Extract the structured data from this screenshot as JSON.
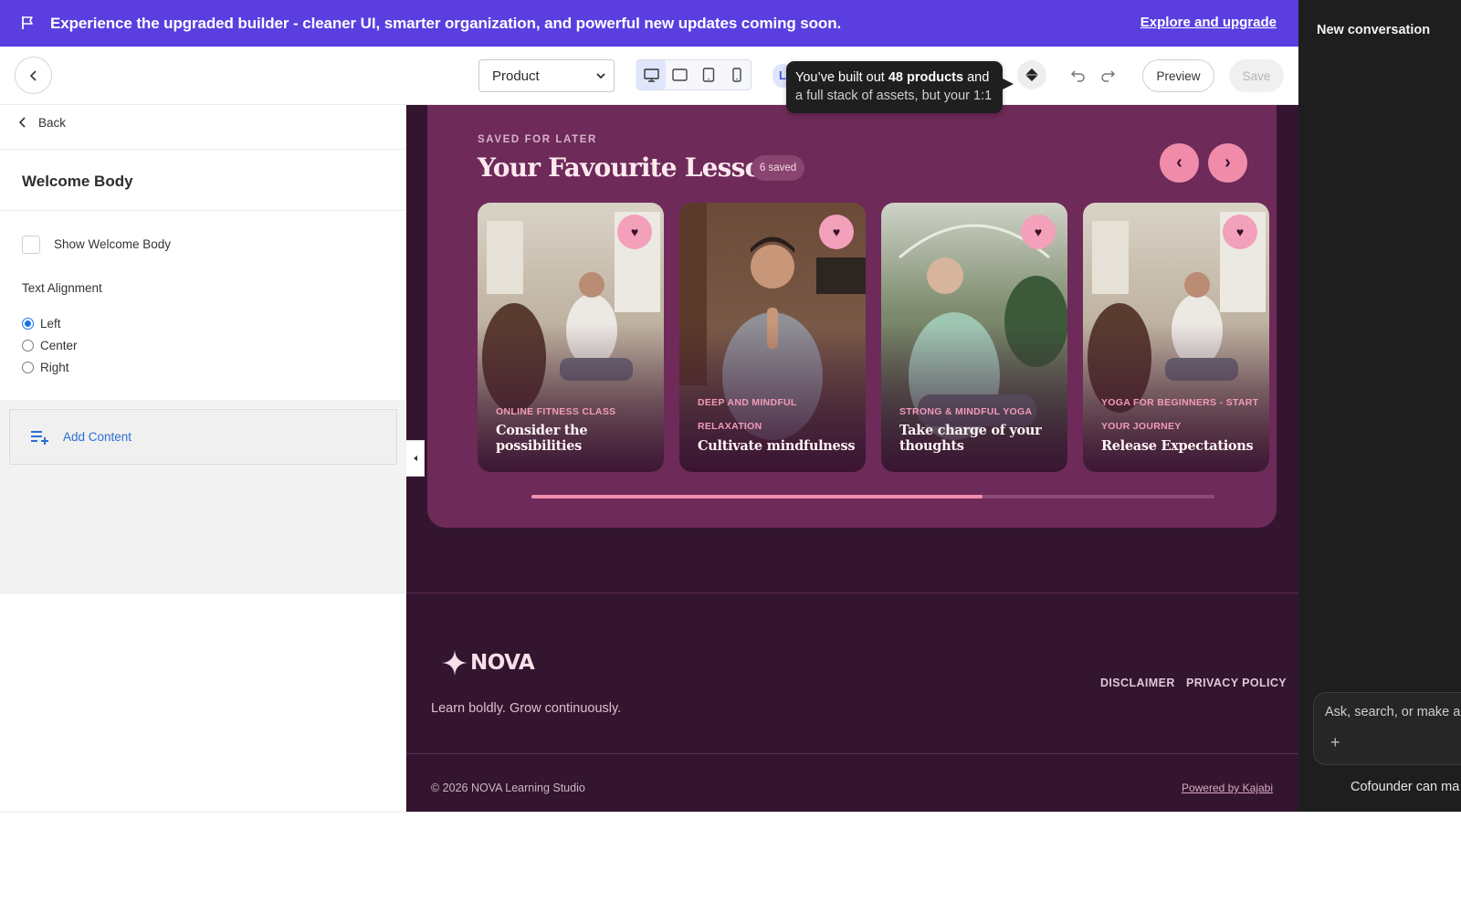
{
  "banner": {
    "message": "Experience the upgraded builder - cleaner UI, smarter organization, and powerful new updates coming soon.",
    "cta": "Explore and upgrade"
  },
  "toolbar": {
    "page_select": "Product",
    "language_chip": "L",
    "tooltip_line1_prefix": "You’ve built out ",
    "tooltip_line1_bold": "48 products",
    "tooltip_line1_suffix": " and",
    "tooltip_line2": "a full stack of assets, but your 1:1",
    "preview_label": "Preview",
    "save_label": "Save"
  },
  "left_panel": {
    "back_label": "Back",
    "title": "Welcome Body",
    "checkbox_label": "Show Welcome Body",
    "alignment_label": "Text Alignment",
    "alignment_options": [
      {
        "label": "Left",
        "checked": true
      },
      {
        "label": "Center",
        "checked": false
      },
      {
        "label": "Right",
        "checked": false
      }
    ],
    "add_content_label": "Add Content"
  },
  "canvas": {
    "eyebrow": "SAVED FOR LATER",
    "title": "Your Favourite Lessons",
    "saved_badge": "6 saved",
    "prev_label": "‹",
    "next_label": "›",
    "lessons": [
      {
        "category_lines": [
          "ONLINE FITNESS CLASS"
        ],
        "title_lines": [
          "Consider the",
          "possibilities"
        ]
      },
      {
        "category_lines": [
          "DEEP AND MINDFUL",
          "RELAXATION"
        ],
        "title_lines": [
          "Cultivate mindfulness"
        ]
      },
      {
        "category_lines": [
          "STRONG & MINDFUL YOGA"
        ],
        "title_lines": [
          "Take charge of your",
          "thoughts"
        ]
      },
      {
        "category_lines": [
          "YOGA FOR BEGINNERS - START",
          "YOUR JOURNEY"
        ],
        "title_lines": [
          "Release Expectations"
        ]
      }
    ],
    "carousel_progress": 0.66,
    "footer": {
      "logo_text": "NOVA",
      "tagline": "Learn boldly. Grow continuously.",
      "links": [
        "DISCLAIMER",
        "PRIVACY POLICY"
      ],
      "copyright": "© 2026 NOVA Learning Studio",
      "powered_by": "Powered by Kajabi"
    }
  },
  "right_panel": {
    "title": "New conversation",
    "input_placeholder": "Ask, search, or make a",
    "add_icon": "+",
    "footer_text": "Cofounder can ma"
  },
  "colors": {
    "banner": "#5a3ee0",
    "canvas_bg": "#341530",
    "card_panel": "#6e2a58",
    "accent_pink": "#f08caa",
    "right_panel": "#1e1e1e"
  },
  "icons": [
    "flag-icon",
    "chevron-left-icon",
    "chevron-down-icon",
    "desktop-icon",
    "tablet-landscape-icon",
    "tablet-portrait-icon",
    "mobile-icon",
    "diamond-icon",
    "undo-icon",
    "redo-icon",
    "playlist-add-icon",
    "heart-icon",
    "sparkle-icon"
  ]
}
